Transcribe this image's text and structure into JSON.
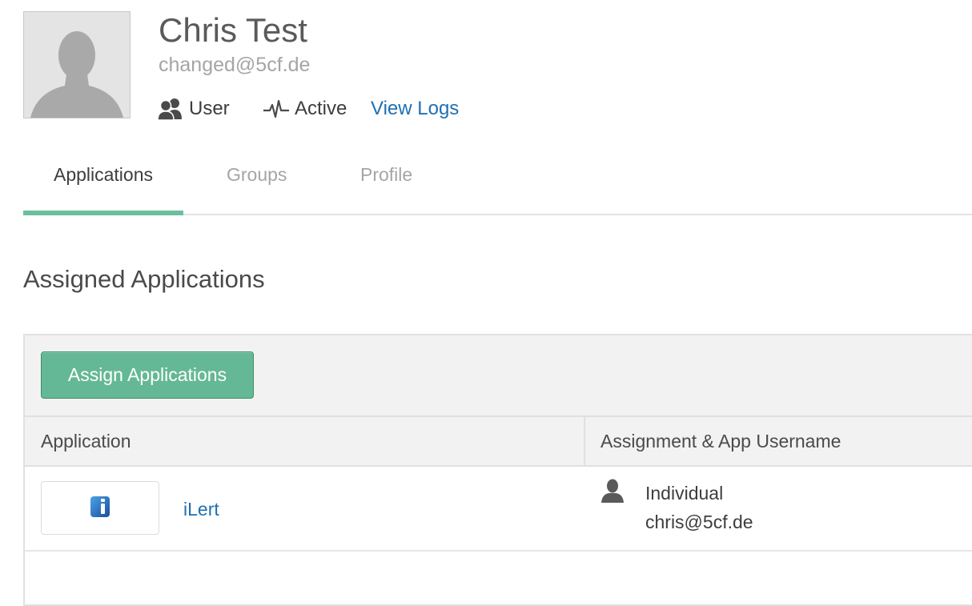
{
  "profile": {
    "name": "Chris Test",
    "email": "changed@5cf.de",
    "role_icon": "user-icon",
    "role": "User",
    "status_icon": "pulse-icon",
    "status": "Active",
    "view_logs": "View Logs"
  },
  "tabs": [
    {
      "label": "Applications",
      "active": true
    },
    {
      "label": "Groups",
      "active": false
    },
    {
      "label": "Profile",
      "active": false
    }
  ],
  "section": {
    "title": "Assigned Applications",
    "assign_button": "Assign Applications"
  },
  "table": {
    "columns": [
      "Application",
      "Assignment & App Username"
    ],
    "rows": [
      {
        "app_icon": "ilert-logo-icon",
        "app_name": "iLert",
        "assignment_icon": "person-icon",
        "assignment_type": "Individual",
        "app_username": "chris@5cf.de"
      }
    ]
  },
  "colors": {
    "accent": "#65b895",
    "tab_underline": "#6cbf9d",
    "link": "#1f6fb2",
    "muted": "#a5a5a5",
    "header_bg": "#f2f2f2"
  }
}
